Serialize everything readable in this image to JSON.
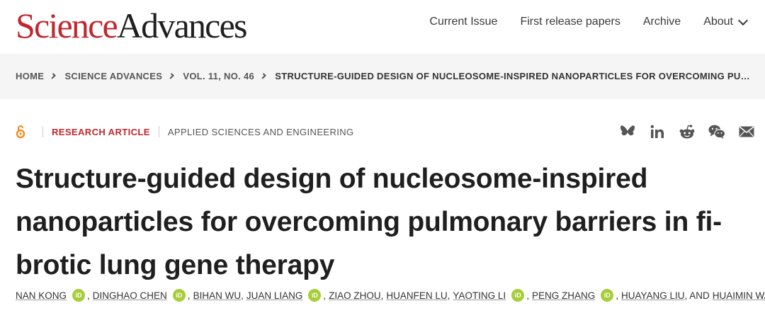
{
  "header": {
    "logo_science": "Science",
    "logo_advances": "Advances",
    "nav": [
      {
        "label": "Current Issue"
      },
      {
        "label": "First release papers"
      },
      {
        "label": "Archive"
      },
      {
        "label": "About"
      }
    ]
  },
  "breadcrumb": {
    "items": [
      "HOME",
      "SCIENCE ADVANCES",
      "VOL. 11, NO. 46"
    ],
    "current": "STRUCTURE-GUIDED DESIGN OF NUCLEOSOME-INSPIRED NANOPARTICLES FOR OVERCOMING PULMONARY BARRIERS IN FIBROTIC LUNG GENE THERAPY"
  },
  "article": {
    "type": "RESEARCH ARTICLE",
    "subject": "APPLIED SCIENCES AND ENGINEERING",
    "title": "Structure-guided design of nucleosome-inspired nanoparticles for overcoming pulmonary barriers in fibrotic lung gene therapy",
    "title_lines": [
      "Structure-guided design of nucleosome-inspired",
      "nanoparticles for overcoming pulmonary barriers in fi-",
      "brotic lung gene therapy"
    ]
  },
  "authors": {
    "list": [
      {
        "name": "NAN KONG",
        "orcid": true,
        "sep": ","
      },
      {
        "name": "DINGHAO CHEN",
        "orcid": true,
        "sep": ","
      },
      {
        "name": "BIHAN WU",
        "orcid": false,
        "sep": ","
      },
      {
        "name": "JUAN LIANG",
        "orcid": true,
        "sep": ","
      },
      {
        "name": "ZIAO ZHOU",
        "orcid": false,
        "sep": ","
      },
      {
        "name": "HUANFEN LU",
        "orcid": false,
        "sep": ","
      },
      {
        "name": "YAOTING LI",
        "orcid": true,
        "sep": ","
      },
      {
        "name": "PENG ZHANG",
        "orcid": true,
        "sep": ","
      },
      {
        "name": "HUAYANG LIU",
        "orcid": false,
        "sep": ", AND"
      },
      {
        "name": "HUAIMIN WANG",
        "orcid": true,
        "sep": ""
      }
    ],
    "orcid_label": "iD"
  },
  "share_icons": [
    "bluesky-icon",
    "linkedin-icon",
    "reddit-icon",
    "wechat-icon",
    "email-icon"
  ],
  "colors": {
    "brand_red": "#c1272d",
    "orcid_green": "#a6ce39",
    "oa_orange": "#f68212"
  }
}
